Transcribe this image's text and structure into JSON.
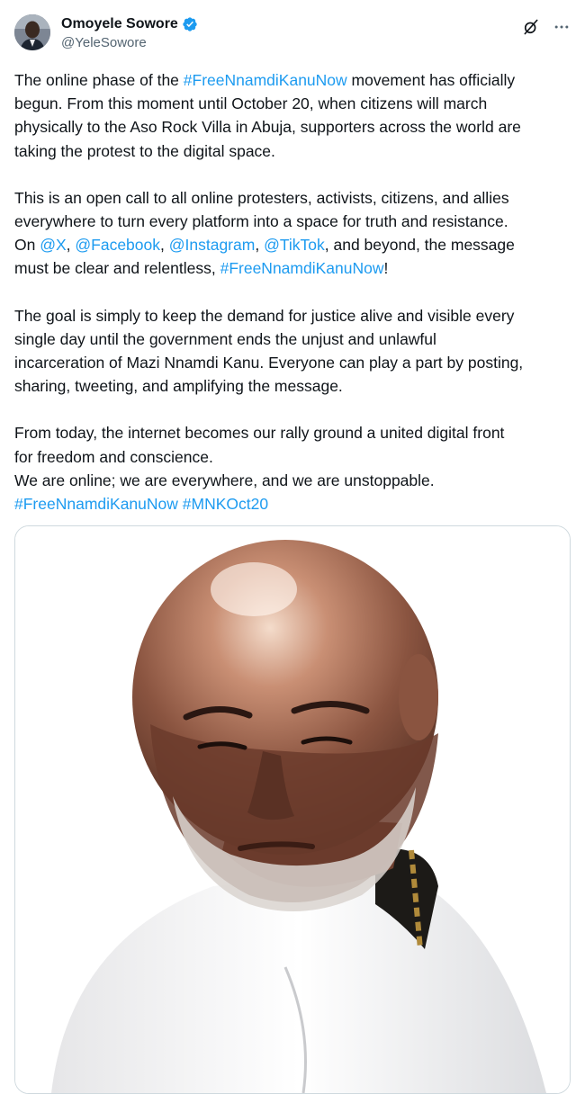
{
  "author": {
    "display_name": "Omoyele Sowore",
    "handle": "@YeleSowore",
    "verified_icon": "verified-badge-icon",
    "avatar_icon": "avatar"
  },
  "actions": {
    "grok_icon": "grok-icon",
    "more_icon": "more-options-icon"
  },
  "post": {
    "p1": {
      "a1": "The online phase of the ",
      "h1": "#FreeNnamdiKanuNow",
      "a2": " movement has officially",
      "l2": "begun. From this moment until October 20, when citizens will march",
      "l3": "physically to the Aso Rock Villa in Abuja, supporters across the world are",
      "l4": "taking the protest to the digital space."
    },
    "p2": {
      "l1": "This is an open call to all online protesters, activists, citizens, and allies",
      "l2": "everywhere to turn every platform into a space for truth and resistance.",
      "on": "On ",
      "m1": "@X",
      "c1": ", ",
      "m2": "@Facebook",
      "c2": ", ",
      "m3": "@Instagram",
      "c3": ", ",
      "m4": "@TikTok",
      "tail": ", and beyond, the message",
      "l4a": "must be clear and relentless, ",
      "h1": "#FreeNnamdiKanuNow",
      "l4b": "!"
    },
    "p3": {
      "l1": "The goal is simply to keep the demand for justice alive and visible every",
      "l2": "single day until the government ends the unjust and unlawful",
      "l3": "incarceration of Mazi Nnamdi Kanu. Everyone can play a part by posting,",
      "l4": "sharing, tweeting, and amplifying the message."
    },
    "p4": {
      "l1": "From today, the internet becomes our rally ground a united digital front",
      "l2": "for freedom and conscience.",
      "l3": "We are online; we are everywhere, and we are unstoppable.",
      "h1": "#FreeNnamdiKanuNow",
      "sp": " ",
      "h2": "#MNKOct20"
    }
  },
  "media": {
    "image_alt": "photo-of-man"
  },
  "colors": {
    "link": "#1d9bf0",
    "text": "#0f1419",
    "secondary": "#536471",
    "verified": "#1d9bf0"
  }
}
